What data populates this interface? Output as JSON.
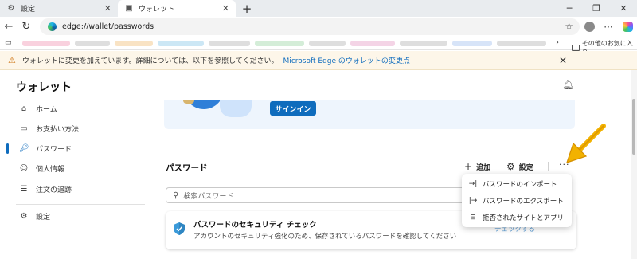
{
  "tabs": [
    {
      "label": "設定",
      "icon": "gear-icon",
      "active": false
    },
    {
      "label": "ウォレット",
      "icon": "wallet-icon",
      "active": true
    }
  ],
  "address": {
    "url": "edge://wallet/passwords"
  },
  "favorites": {
    "other_label": "その他のお気に入り"
  },
  "infobar": {
    "message": "ウォレットに変更を加えています。詳細については、以下を参照してください。",
    "link": "Microsoft Edge のウォレットの変更点"
  },
  "sidebar": {
    "title": "ウォレット",
    "items": [
      {
        "label": "ホーム",
        "icon": "home-icon"
      },
      {
        "label": "お支払い方法",
        "icon": "card-icon"
      },
      {
        "label": "パスワード",
        "icon": "key-icon",
        "active": true
      },
      {
        "label": "個人情報",
        "icon": "person-icon"
      },
      {
        "label": "注文の追跡",
        "icon": "order-icon"
      },
      {
        "label": "設定",
        "icon": "gear-icon"
      }
    ]
  },
  "banner": {
    "signin_label": "サインイン"
  },
  "passwords": {
    "heading": "パスワード",
    "add_label": "追加",
    "settings_label": "設定",
    "search_placeholder": "検索パスワード",
    "security_card": {
      "title": "パスワードのセキュリティ チェック",
      "description": "アカウントのセキュリティ強化のため、保存されているパスワードを確認してください",
      "link": "チェックする"
    }
  },
  "menu": {
    "items": [
      {
        "label": "パスワードのインポート",
        "icon": "import-icon"
      },
      {
        "label": "パスワードのエクスポート",
        "icon": "export-icon"
      },
      {
        "label": "拒否されたサイトとアプリ",
        "icon": "blocked-sites-icon"
      }
    ]
  },
  "colors": {
    "accent": "#0f6cbd",
    "annotation_arrow": "#f2b200",
    "warning": "#d07a1c"
  }
}
